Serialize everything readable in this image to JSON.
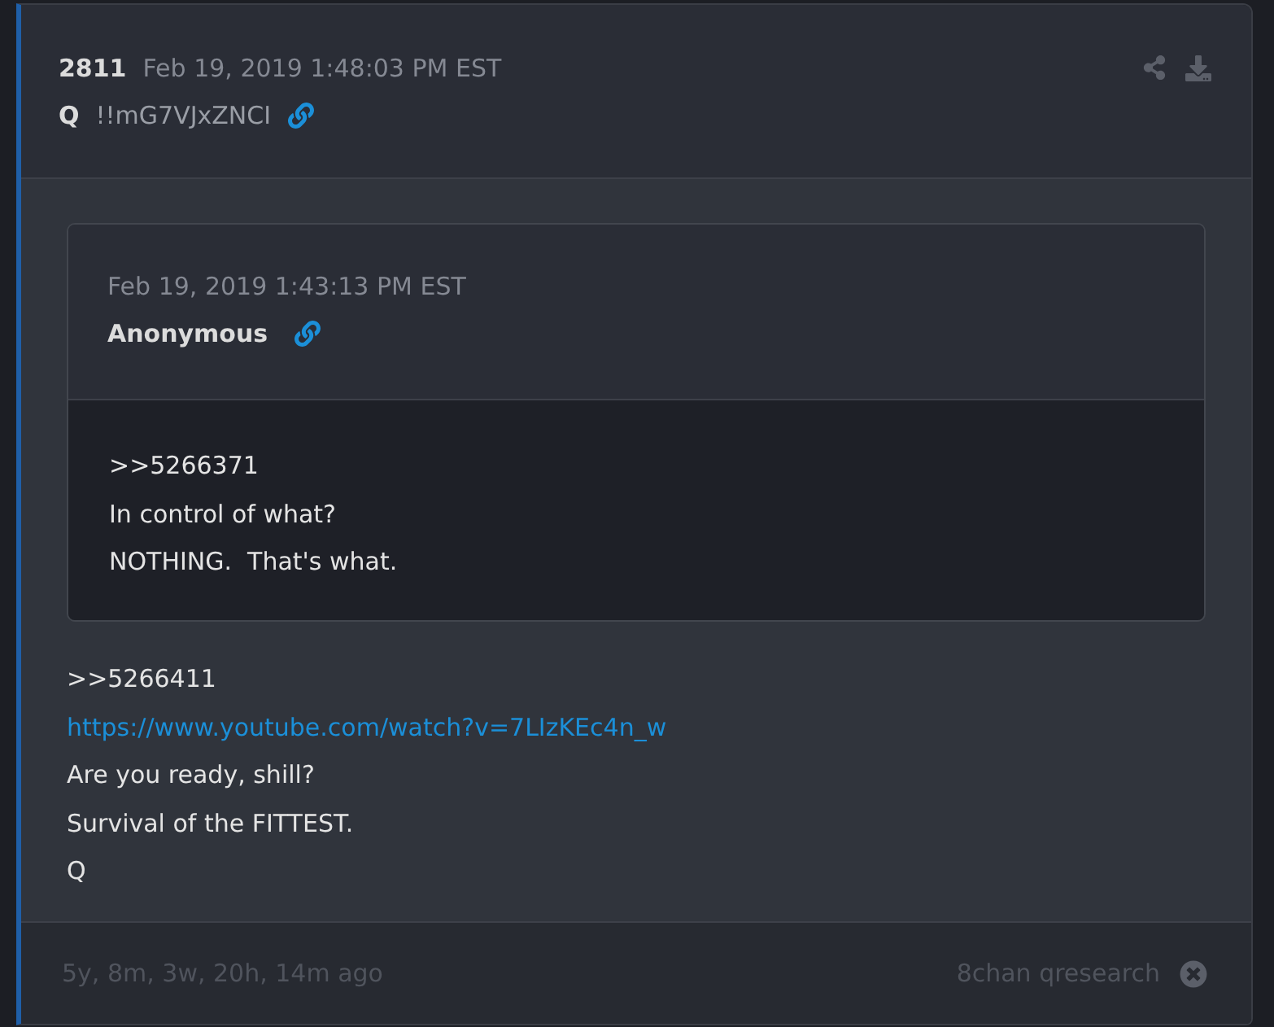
{
  "post": {
    "number": "2811",
    "timestamp": "Feb 19, 2019 1:48:03 PM EST",
    "author": "Q",
    "tripcode": "!!mG7VJxZNCI"
  },
  "quoted_post": {
    "timestamp": "Feb 19, 2019 1:43:13 PM EST",
    "author": "Anonymous",
    "lines": [
      ">>5266371",
      "In control of what?",
      "NOTHING.  That's what."
    ]
  },
  "body": {
    "lines": [
      {
        "kind": "text",
        "text": ">>5266411"
      },
      {
        "kind": "link",
        "text": "https://www.youtube.com/watch?v=7LIzKEc4n_w"
      },
      {
        "kind": "text",
        "text": "Are you ready, shill?"
      },
      {
        "kind": "text",
        "text": "Survival of the FITTEST."
      },
      {
        "kind": "text",
        "text": "Q"
      }
    ]
  },
  "footer": {
    "age": "5y, 8m, 3w, 20h, 14m ago",
    "source": "8chan qresearch"
  }
}
